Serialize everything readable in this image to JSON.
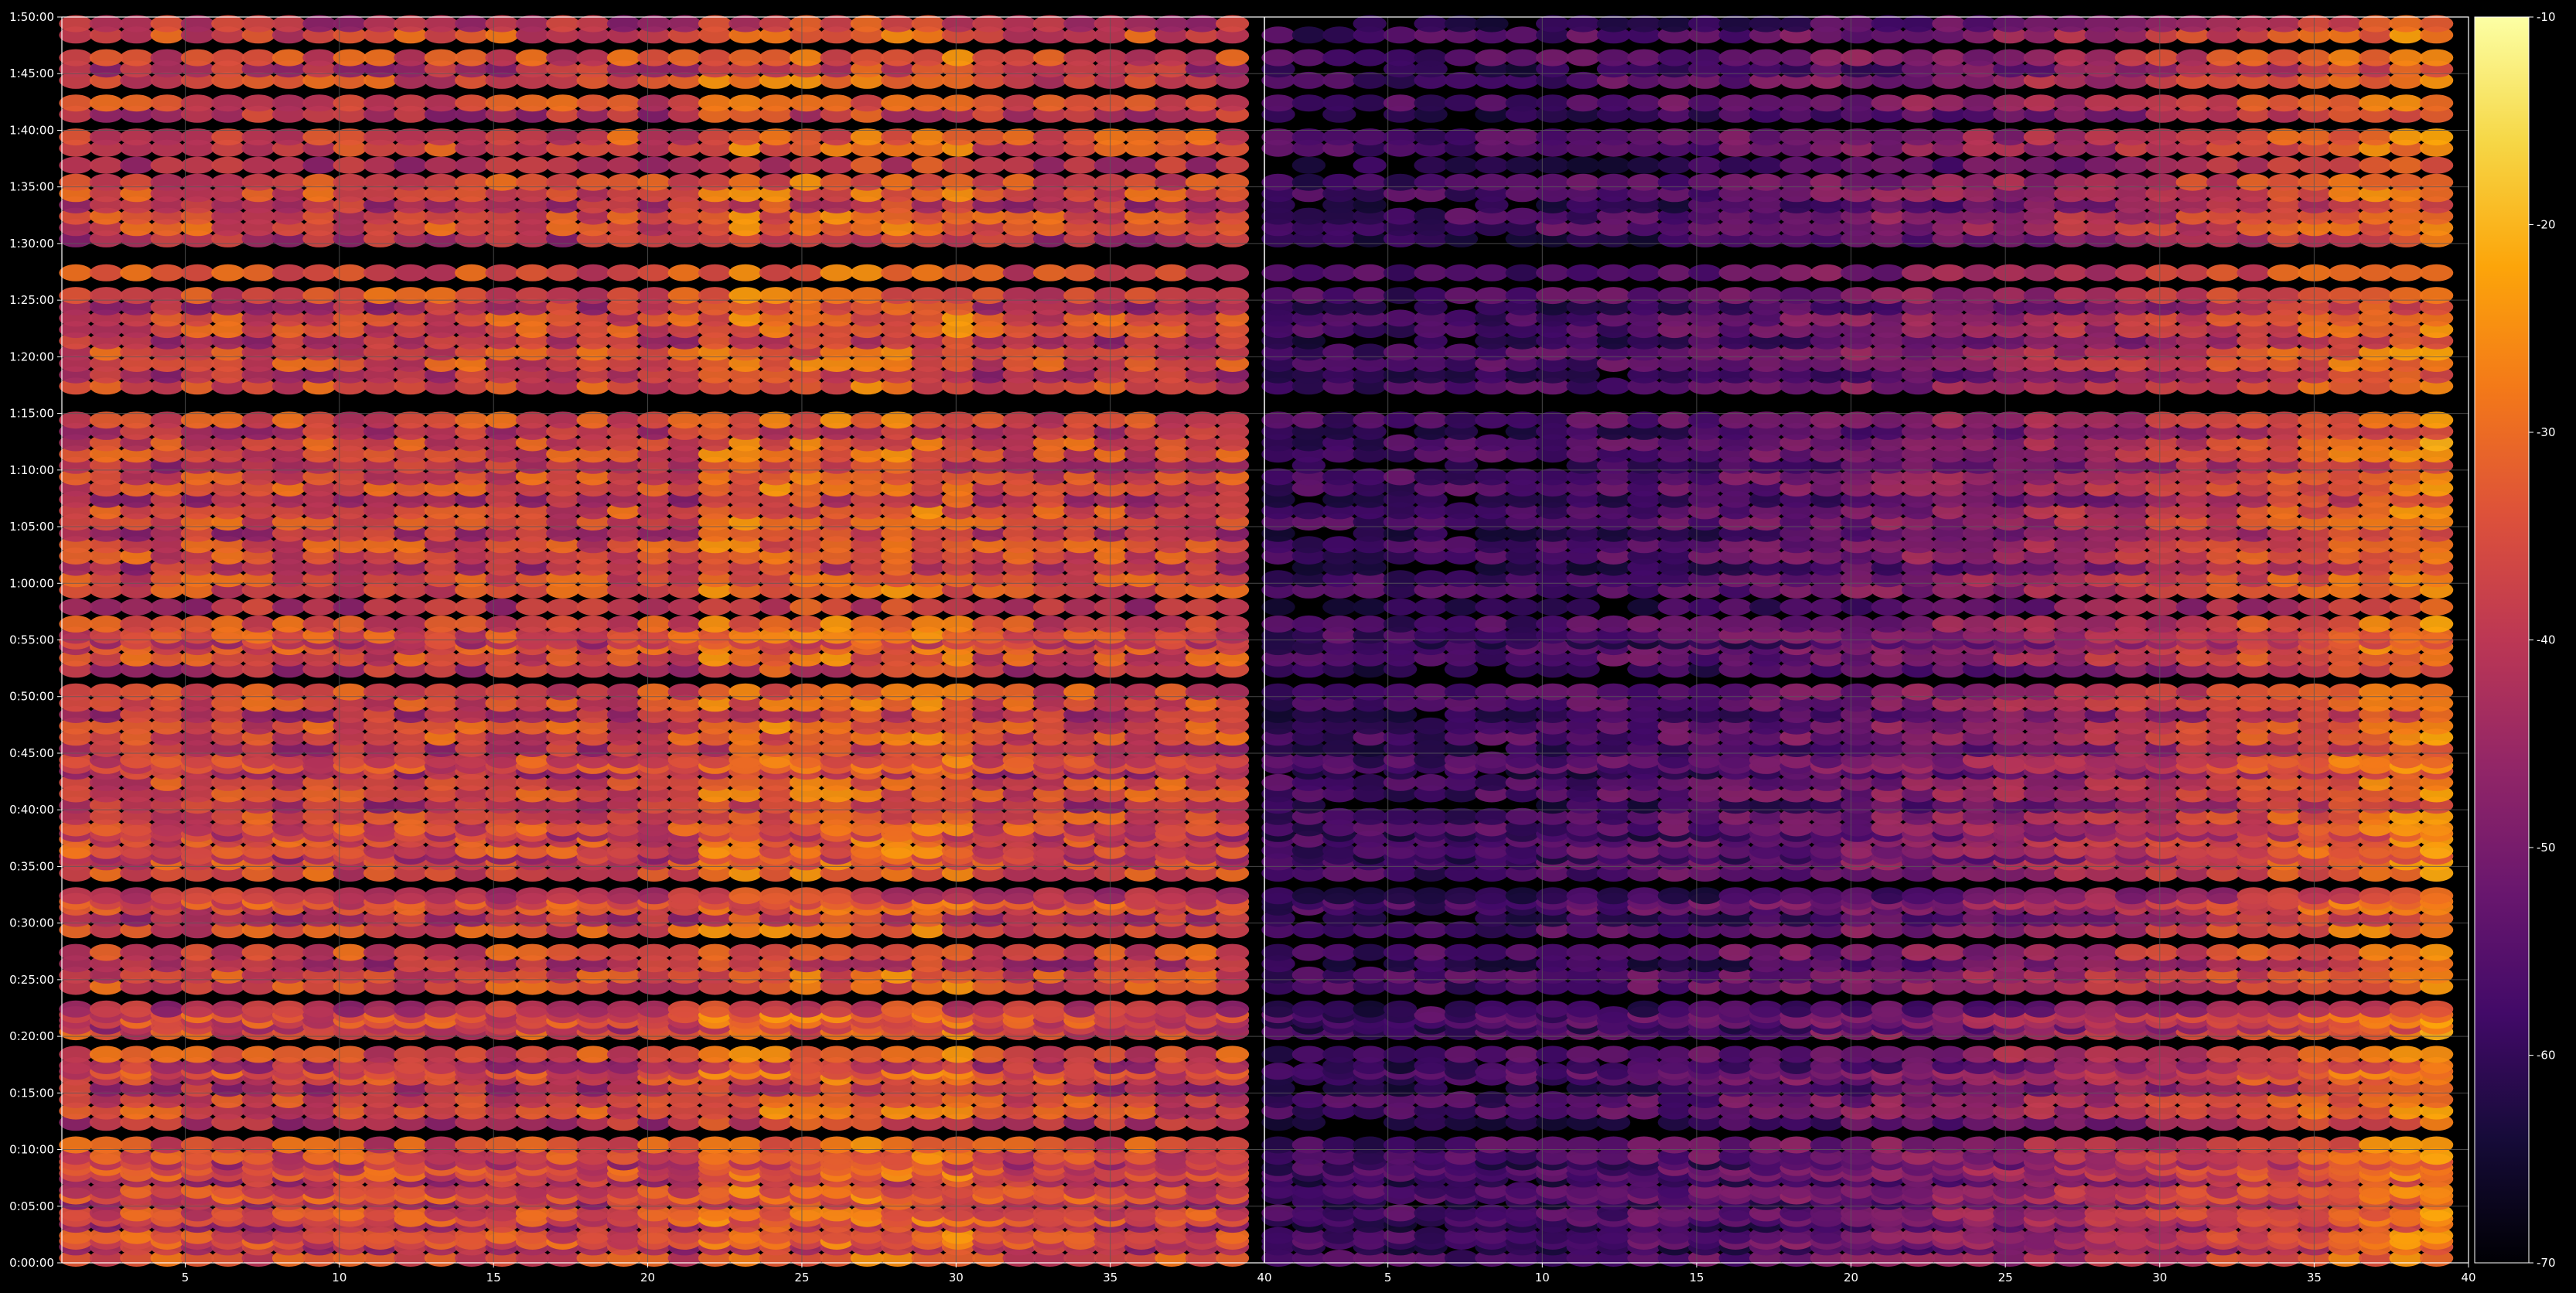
{
  "chart_data": {
    "type": "heatmap",
    "title": "",
    "xlabel": "",
    "ylabel": "",
    "panels": [
      {
        "name": "",
        "xlim": [
          1,
          40
        ],
        "x_ticks": [
          "5",
          "10",
          "15",
          "20",
          "25",
          "30",
          "35"
        ]
      },
      {
        "name": "",
        "xlim": [
          1,
          40
        ],
        "x_ticks": [
          "5",
          "10",
          "15",
          "20",
          "25",
          "30",
          "35",
          "40"
        ]
      }
    ],
    "shared_x_tick_40": "40",
    "ylim_seconds": [
      0,
      6600
    ],
    "y_ticks": [
      "0:00:00",
      "0:05:00",
      "0:10:00",
      "0:15:00",
      "0:20:00",
      "0:25:00",
      "0:30:00",
      "0:35:00",
      "0:40:00",
      "0:45:00",
      "0:50:00",
      "0:55:00",
      "1:00:00",
      "1:05:00",
      "1:10:00",
      "1:15:00",
      "1:20:00",
      "1:25:00",
      "1:30:00",
      "1:35:00",
      "1:40:00",
      "1:45:00",
      "1:50:00"
    ],
    "colorbar": {
      "colormap": "inferno",
      "range": [
        -70,
        -10
      ],
      "ticks": [
        "-10",
        "-20",
        "-30",
        "-40",
        "-50",
        "-60",
        "-70"
      ]
    },
    "grid": true,
    "background": "#000000",
    "grid_color": "#5a5a5a",
    "band_seconds": [
      0,
      60,
      90,
      120,
      180,
      210,
      240,
      300,
      330,
      360,
      420,
      450,
      480,
      510,
      540,
      600,
      720,
      780,
      840,
      900,
      960,
      990,
      1020,
      1080,
      1200,
      1230,
      1260,
      1290,
      1320,
      1440,
      1500,
      1560,
      1620,
      1740,
      1800,
      1860,
      1890,
      1920,
      2040,
      2100,
      2130,
      2160,
      2220,
      2250,
      2280,
      2340,
      2400,
      2460,
      2520,
      2580,
      2610,
      2640,
      2700,
      2760,
      2820,
      2880,
      2940,
      3000,
      3120,
      3180,
      3240,
      3270,
      3300,
      3360,
      3450,
      3540,
      3600,
      3660,
      3720,
      3780,
      3840,
      3900,
      3960,
      4020,
      4080,
      4140,
      4200,
      4260,
      4320,
      4380,
      4440,
      4620,
      4680,
      4740,
      4800,
      4860,
      4920,
      4980,
      5040,
      5100,
      5220,
      5400,
      5460,
      5520,
      5580,
      5640,
      5700,
      5790,
      5880,
      5940,
      6060,
      6120,
      6240,
      6300,
      6360,
      6480,
      6540
    ]
  }
}
